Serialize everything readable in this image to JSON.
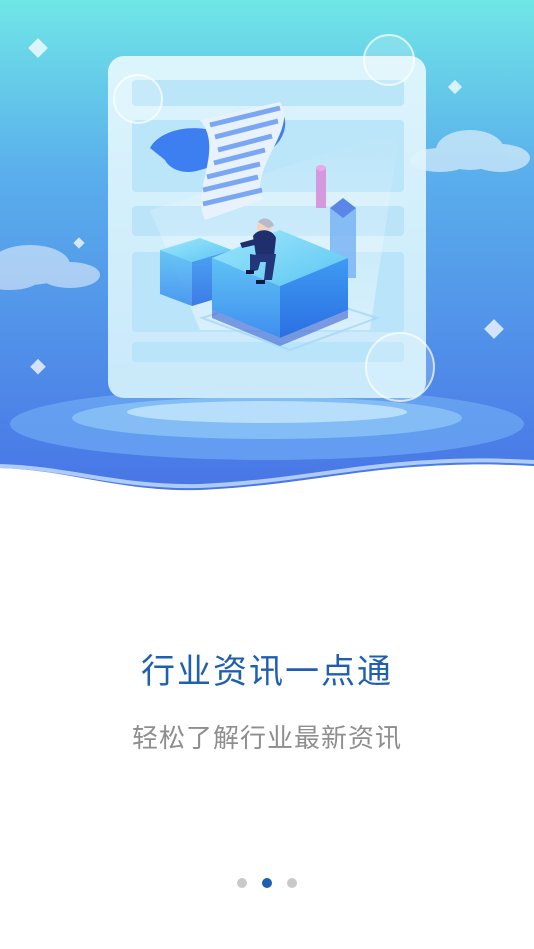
{
  "onboarding": {
    "title": "行业资讯一点通",
    "subtitle": "轻松了解行业最新资讯",
    "illustration": "document-with-person-on-cube",
    "pager": {
      "total": 3,
      "current": 2
    }
  },
  "colors": {
    "title": "#1f5fb0",
    "subtitle": "#8e8e8e",
    "dot_active": "#1f5fb0",
    "dot_inactive": "#c9c9c9",
    "hero_top": "#6fe0e8",
    "hero_bottom": "#4a7fe8"
  }
}
